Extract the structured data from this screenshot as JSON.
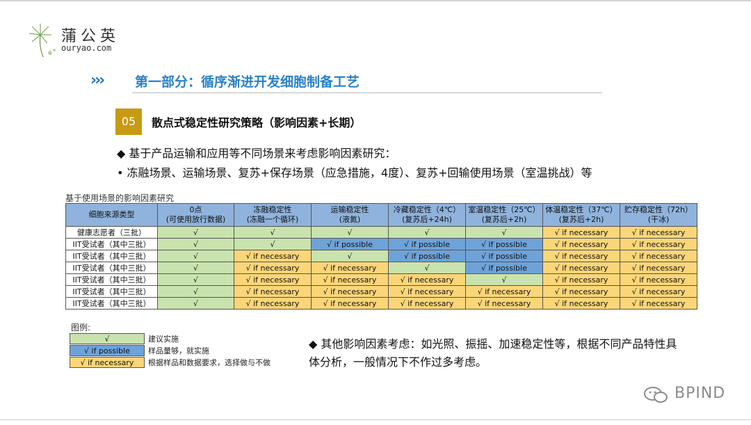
{
  "logo": {
    "name": "蒲公英",
    "url": "ouryao.com"
  },
  "section": {
    "arrows": "›››",
    "title": "第一部分：循序渐进开发细胞制备工艺"
  },
  "subsection": {
    "number": "05",
    "title": "散点式稳定性研究策略（影响因素+长期）"
  },
  "bullets": {
    "b1": "◆ 基于产品运输和应用等不同场景来考虑影响因素研究：",
    "b2": "•   冻融场景、运输场景、复苏+保存场景（应急措施，4度）、复苏+回输使用场景（室温挑战）等",
    "b3": "◆ 其他影响因素考虑：如光照、振摇、加速稳定性等，根据不同产品特性具体分析，一般情况下不作过多考虑。"
  },
  "table": {
    "caption": "基于使用场景的影响因素研究",
    "headers": [
      [
        "细胞来源类型",
        ""
      ],
      [
        "0点",
        "(可使用放行数据)"
      ],
      [
        "冻融稳定性",
        "(冻融一个循环)"
      ],
      [
        "运输稳定性",
        "(液氮)"
      ],
      [
        "冷藏稳定性（4℃）",
        "(复苏后+24h)"
      ],
      [
        "室温稳定性（25℃）",
        "(复苏后+2h)"
      ],
      [
        "体温稳定性（37℃）",
        "(复苏后+2h)"
      ],
      [
        "贮存稳定性（72h）",
        "(干冰)"
      ]
    ],
    "rows": [
      {
        "label": "健康志愿者（三批）",
        "cells": [
          [
            "√",
            "g"
          ],
          [
            "√",
            "g"
          ],
          [
            "√",
            "g"
          ],
          [
            "√",
            "g"
          ],
          [
            "√",
            "g"
          ],
          [
            "√  if necessary",
            "y"
          ],
          [
            "√  if necessary",
            "y"
          ]
        ]
      },
      {
        "label": "IIT受试者（其中三批）",
        "cells": [
          [
            "√",
            "g"
          ],
          [
            "√",
            "g"
          ],
          [
            "√  if possible",
            "b"
          ],
          [
            "√  if possible",
            "b"
          ],
          [
            "√  if possible",
            "b"
          ],
          [
            "√  if necessary",
            "y"
          ],
          [
            "√  if necessary",
            "y"
          ]
        ]
      },
      {
        "label": "IIT受试者（其中三批）",
        "cells": [
          [
            "√",
            "g"
          ],
          [
            "√  if necessary",
            "y"
          ],
          [
            "√",
            "g"
          ],
          [
            "√  if possible",
            "b"
          ],
          [
            "√  if possible",
            "b"
          ],
          [
            "√  if necessary",
            "y"
          ],
          [
            "√  if necessary",
            "y"
          ]
        ]
      },
      {
        "label": "IIT受试者（其中三批）",
        "cells": [
          [
            "√",
            "g"
          ],
          [
            "√  if necessary",
            "y"
          ],
          [
            "√  if necessary",
            "y"
          ],
          [
            "√",
            "g"
          ],
          [
            "√  if possible",
            "b"
          ],
          [
            "√  if necessary",
            "y"
          ],
          [
            "√  if necessary",
            "y"
          ]
        ]
      },
      {
        "label": "IIT受试者（其中三批）",
        "cells": [
          [
            "√",
            "g"
          ],
          [
            "√  if necessary",
            "y"
          ],
          [
            "√  if necessary",
            "y"
          ],
          [
            "√  if necessary",
            "y"
          ],
          [
            "√",
            "g"
          ],
          [
            "√  if necessary",
            "y"
          ],
          [
            "√  if necessary",
            "y"
          ]
        ]
      },
      {
        "label": "IIT受试者（其中三批）",
        "cells": [
          [
            "√",
            "g"
          ],
          [
            "√  if necessary",
            "y"
          ],
          [
            "√  if necessary",
            "y"
          ],
          [
            "√  if necessary",
            "y"
          ],
          [
            "√  if necessary",
            "y"
          ],
          [
            "√  if necessary",
            "y"
          ],
          [
            "√  if necessary",
            "y"
          ]
        ]
      },
      {
        "label": "IIT受试者（其中三批）",
        "cells": [
          [
            "√",
            "g"
          ],
          [
            "√  if necessary",
            "y"
          ],
          [
            "√  if necessary",
            "y"
          ],
          [
            "√  if necessary",
            "y"
          ],
          [
            "√  if necessary",
            "y"
          ],
          [
            "√  if necessary",
            "y"
          ],
          [
            "√  if necessary",
            "y"
          ]
        ]
      }
    ]
  },
  "legend": {
    "title": "图例:",
    "items": [
      {
        "swatch": "√",
        "text": "建议实施",
        "color": "#c9e3ae"
      },
      {
        "swatch": "√  if possible",
        "text": "样品量够，就实施",
        "color": "#6ea3d9"
      },
      {
        "swatch": "√  if necessary",
        "text": "根据样品和数据要求，选择做与不做",
        "color": "#fbd678"
      }
    ]
  },
  "watermark": {
    "icon": "wechat-icon",
    "text": "BPIND"
  },
  "colors": {
    "accent_blue": "#2a82c7",
    "badge_gold": "#c89a13",
    "header_blue": "#8fb3dc"
  }
}
